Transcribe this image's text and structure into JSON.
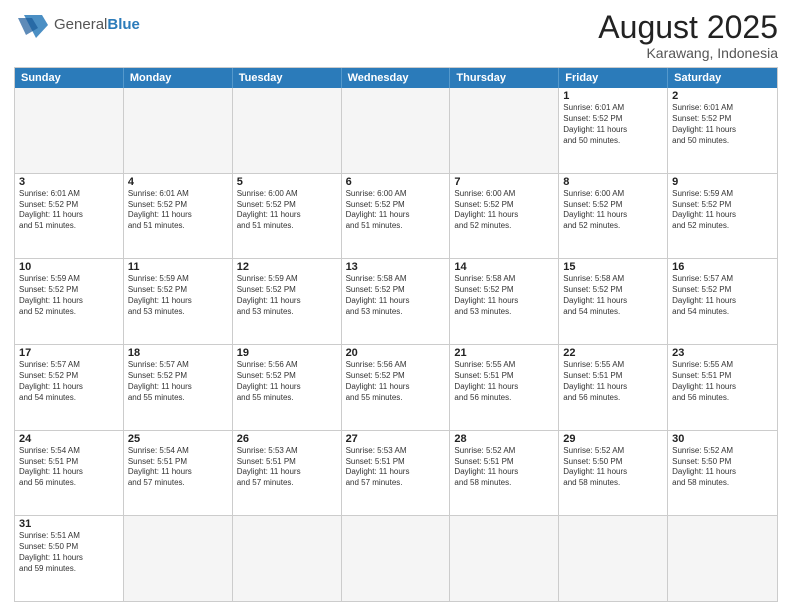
{
  "header": {
    "logo_general": "General",
    "logo_blue": "Blue",
    "main_title": "August 2025",
    "subtitle": "Karawang, Indonesia"
  },
  "weekdays": [
    "Sunday",
    "Monday",
    "Tuesday",
    "Wednesday",
    "Thursday",
    "Friday",
    "Saturday"
  ],
  "rows": [
    {
      "cells": [
        {
          "empty": true
        },
        {
          "empty": true
        },
        {
          "empty": true
        },
        {
          "empty": true
        },
        {
          "empty": true
        },
        {
          "num": "1",
          "info": "Sunrise: 6:01 AM\nSunset: 5:52 PM\nDaylight: 11 hours\nand 50 minutes."
        },
        {
          "num": "2",
          "info": "Sunrise: 6:01 AM\nSunset: 5:52 PM\nDaylight: 11 hours\nand 50 minutes."
        }
      ]
    },
    {
      "cells": [
        {
          "num": "3",
          "info": "Sunrise: 6:01 AM\nSunset: 5:52 PM\nDaylight: 11 hours\nand 51 minutes."
        },
        {
          "num": "4",
          "info": "Sunrise: 6:01 AM\nSunset: 5:52 PM\nDaylight: 11 hours\nand 51 minutes."
        },
        {
          "num": "5",
          "info": "Sunrise: 6:00 AM\nSunset: 5:52 PM\nDaylight: 11 hours\nand 51 minutes."
        },
        {
          "num": "6",
          "info": "Sunrise: 6:00 AM\nSunset: 5:52 PM\nDaylight: 11 hours\nand 51 minutes."
        },
        {
          "num": "7",
          "info": "Sunrise: 6:00 AM\nSunset: 5:52 PM\nDaylight: 11 hours\nand 52 minutes."
        },
        {
          "num": "8",
          "info": "Sunrise: 6:00 AM\nSunset: 5:52 PM\nDaylight: 11 hours\nand 52 minutes."
        },
        {
          "num": "9",
          "info": "Sunrise: 5:59 AM\nSunset: 5:52 PM\nDaylight: 11 hours\nand 52 minutes."
        }
      ]
    },
    {
      "cells": [
        {
          "num": "10",
          "info": "Sunrise: 5:59 AM\nSunset: 5:52 PM\nDaylight: 11 hours\nand 52 minutes."
        },
        {
          "num": "11",
          "info": "Sunrise: 5:59 AM\nSunset: 5:52 PM\nDaylight: 11 hours\nand 53 minutes."
        },
        {
          "num": "12",
          "info": "Sunrise: 5:59 AM\nSunset: 5:52 PM\nDaylight: 11 hours\nand 53 minutes."
        },
        {
          "num": "13",
          "info": "Sunrise: 5:58 AM\nSunset: 5:52 PM\nDaylight: 11 hours\nand 53 minutes."
        },
        {
          "num": "14",
          "info": "Sunrise: 5:58 AM\nSunset: 5:52 PM\nDaylight: 11 hours\nand 53 minutes."
        },
        {
          "num": "15",
          "info": "Sunrise: 5:58 AM\nSunset: 5:52 PM\nDaylight: 11 hours\nand 54 minutes."
        },
        {
          "num": "16",
          "info": "Sunrise: 5:57 AM\nSunset: 5:52 PM\nDaylight: 11 hours\nand 54 minutes."
        }
      ]
    },
    {
      "cells": [
        {
          "num": "17",
          "info": "Sunrise: 5:57 AM\nSunset: 5:52 PM\nDaylight: 11 hours\nand 54 minutes."
        },
        {
          "num": "18",
          "info": "Sunrise: 5:57 AM\nSunset: 5:52 PM\nDaylight: 11 hours\nand 55 minutes."
        },
        {
          "num": "19",
          "info": "Sunrise: 5:56 AM\nSunset: 5:52 PM\nDaylight: 11 hours\nand 55 minutes."
        },
        {
          "num": "20",
          "info": "Sunrise: 5:56 AM\nSunset: 5:52 PM\nDaylight: 11 hours\nand 55 minutes."
        },
        {
          "num": "21",
          "info": "Sunrise: 5:55 AM\nSunset: 5:51 PM\nDaylight: 11 hours\nand 56 minutes."
        },
        {
          "num": "22",
          "info": "Sunrise: 5:55 AM\nSunset: 5:51 PM\nDaylight: 11 hours\nand 56 minutes."
        },
        {
          "num": "23",
          "info": "Sunrise: 5:55 AM\nSunset: 5:51 PM\nDaylight: 11 hours\nand 56 minutes."
        }
      ]
    },
    {
      "cells": [
        {
          "num": "24",
          "info": "Sunrise: 5:54 AM\nSunset: 5:51 PM\nDaylight: 11 hours\nand 56 minutes."
        },
        {
          "num": "25",
          "info": "Sunrise: 5:54 AM\nSunset: 5:51 PM\nDaylight: 11 hours\nand 57 minutes."
        },
        {
          "num": "26",
          "info": "Sunrise: 5:53 AM\nSunset: 5:51 PM\nDaylight: 11 hours\nand 57 minutes."
        },
        {
          "num": "27",
          "info": "Sunrise: 5:53 AM\nSunset: 5:51 PM\nDaylight: 11 hours\nand 57 minutes."
        },
        {
          "num": "28",
          "info": "Sunrise: 5:52 AM\nSunset: 5:51 PM\nDaylight: 11 hours\nand 58 minutes."
        },
        {
          "num": "29",
          "info": "Sunrise: 5:52 AM\nSunset: 5:50 PM\nDaylight: 11 hours\nand 58 minutes."
        },
        {
          "num": "30",
          "info": "Sunrise: 5:52 AM\nSunset: 5:50 PM\nDaylight: 11 hours\nand 58 minutes."
        }
      ]
    },
    {
      "cells": [
        {
          "num": "31",
          "info": "Sunrise: 5:51 AM\nSunset: 5:50 PM\nDaylight: 11 hours\nand 59 minutes."
        },
        {
          "empty": true
        },
        {
          "empty": true
        },
        {
          "empty": true
        },
        {
          "empty": true
        },
        {
          "empty": true
        },
        {
          "empty": true
        }
      ]
    }
  ]
}
